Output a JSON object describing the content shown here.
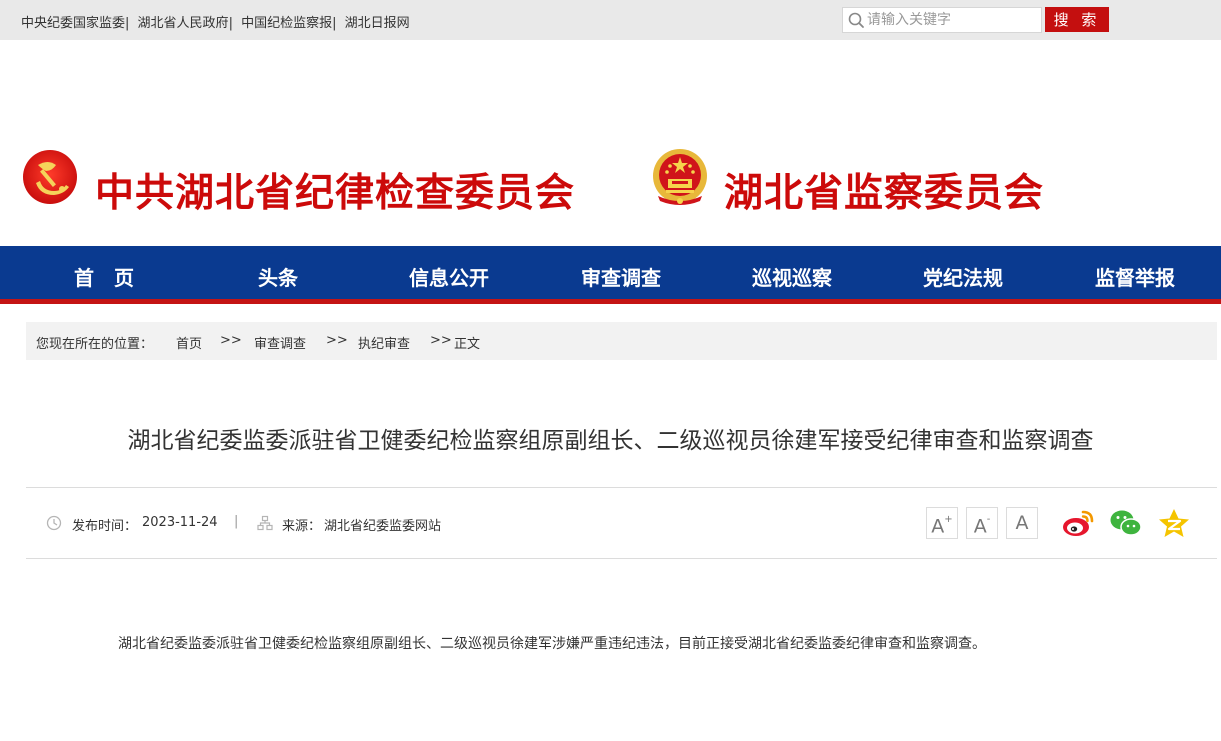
{
  "toplinks": [
    "中央纪委国家监委",
    "湖北省人民政府",
    "中国纪检监察报",
    "湖北日报网"
  ],
  "search": {
    "placeholder": "请输入关键字",
    "button": "搜 索"
  },
  "banner": {
    "org1": "中共湖北省纪律检查委员会",
    "org2": "湖北省监察委员会"
  },
  "nav": [
    "首　页",
    "头条",
    "信息公开",
    "审查调查",
    "巡视巡察",
    "党纪法规",
    "监督举报"
  ],
  "breadcrumb": {
    "label": "您现在所在的位置：",
    "items": [
      "首页",
      "审查调查",
      "执纪审查",
      "正文"
    ],
    "sep": ">>"
  },
  "article": {
    "title": "湖北省纪委监委派驻省卫健委纪检监察组原副组长、二级巡视员徐建军接受纪律审查和监察调查",
    "publish_label": "发布时间：",
    "publish_date": "2023-11-24",
    "source_label": "来源：",
    "source": "湖北省纪委监委网站",
    "body": "湖北省纪委监委派驻省卫健委纪检监察组原副组长、二级巡视员徐建军涉嫌严重违纪违法，目前正接受湖北省纪委监委纪律审查和监察调查。"
  },
  "font_controls": {
    "large": "A",
    "medium": "A",
    "small": "A"
  },
  "colors": {
    "brand_red": "#cc0a0a",
    "nav_blue": "#0a3a90",
    "nav_red_line": "#c41414"
  }
}
